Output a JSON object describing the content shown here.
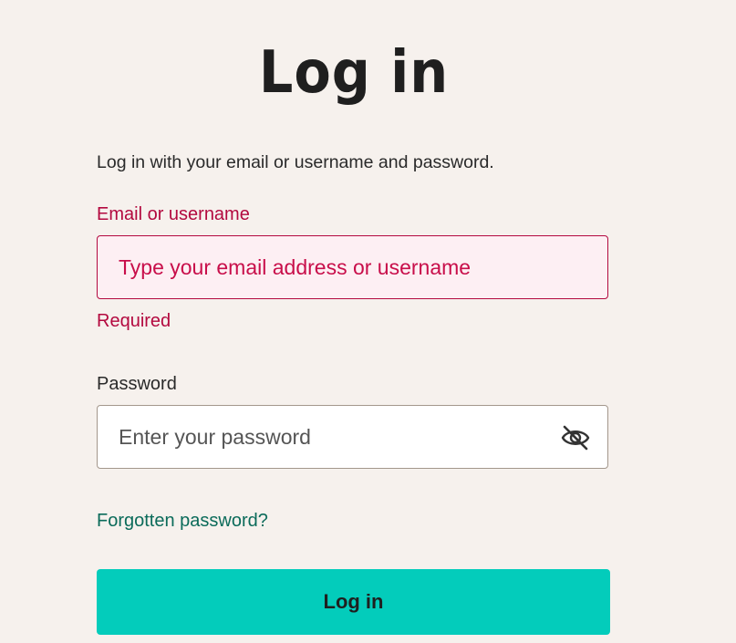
{
  "page": {
    "title": "Log in",
    "subtitle": "Log in with your email or username and password."
  },
  "email_field": {
    "label": "Email or username",
    "placeholder": "Type your email address or username",
    "value": "",
    "error": "Required"
  },
  "password_field": {
    "label": "Password",
    "placeholder": "Enter your password",
    "value": "",
    "toggle_icon": "eye-slash-icon"
  },
  "links": {
    "forgot_password": "Forgotten password?"
  },
  "actions": {
    "login_label": "Log in"
  },
  "colors": {
    "background": "#f6f1ed",
    "error": "#b3093f",
    "error_field_bg": "#fdeff3",
    "link": "#0b6b5a",
    "primary_button": "#03ccbb"
  }
}
